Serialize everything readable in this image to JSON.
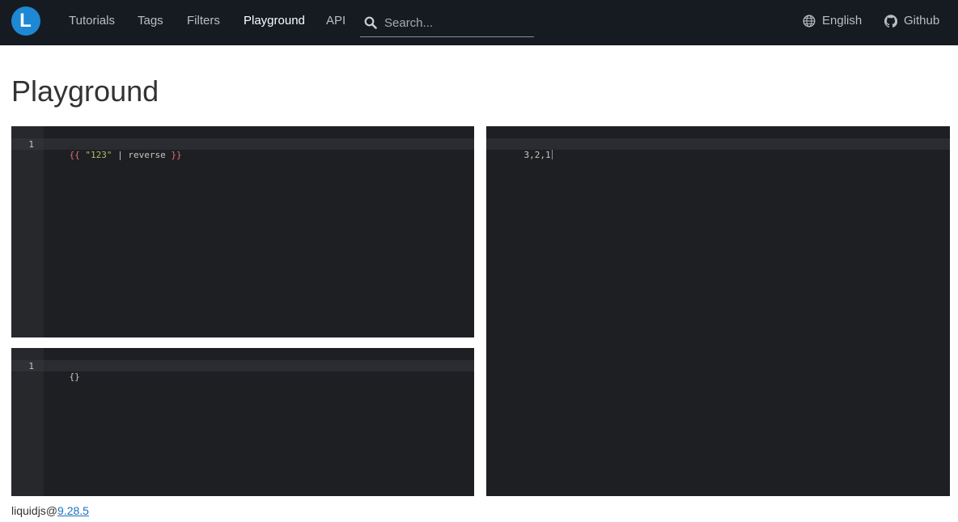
{
  "nav": {
    "logo_letter": "L",
    "links": [
      "Tutorials",
      "Tags",
      "Filters",
      "Playground",
      "API"
    ],
    "search_placeholder": "Search...",
    "language": "English",
    "github": "Github"
  },
  "page": {
    "title": "Playground"
  },
  "template_editor": {
    "line_number": "1",
    "open_brace": "{{",
    "string": "\"123\"",
    "pipe_filter": "| reverse",
    "close_brace": "}}"
  },
  "context_editor": {
    "line_number": "1",
    "code": "{}"
  },
  "output_editor": {
    "code": "3,2,1"
  },
  "footer": {
    "package": "liquidjs@",
    "version": "9.28.5"
  },
  "colors": {
    "navbar": "#161b22",
    "logo": "#1e88d4",
    "editor_bg": "#1e1f22",
    "link": "#1e6fc0"
  }
}
